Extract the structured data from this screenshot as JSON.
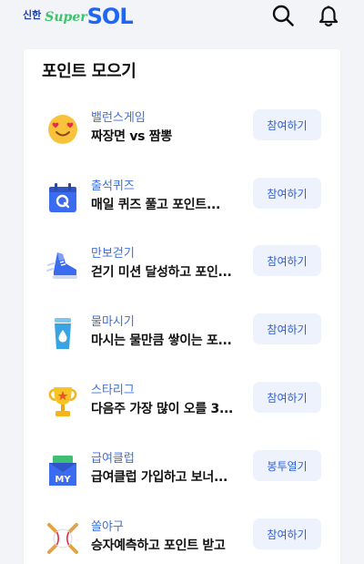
{
  "header": {
    "logo_prefix": "신한",
    "logo_super": "Super",
    "logo_sol": "SOL"
  },
  "section": {
    "title": "포인트 모으기"
  },
  "items": [
    {
      "category": "밸런스게임",
      "description": "짜장면 vs 짬뽕",
      "button": "참여하기",
      "icon": "heart-eyes-emoji-icon"
    },
    {
      "category": "출석퀴즈",
      "description": "매일 퀴즈 풀고 포인트...",
      "button": "참여하기",
      "icon": "quiz-calendar-icon"
    },
    {
      "category": "만보걷기",
      "description": "걷기 미션 달성하고 포인...",
      "button": "참여하기",
      "icon": "sneaker-icon"
    },
    {
      "category": "물마시기",
      "description": "마시는 물만큼 쌓이는 포...",
      "button": "참여하기",
      "icon": "water-cup-icon"
    },
    {
      "category": "스타리그",
      "description": "다음주 가장 많이 오를 3...",
      "button": "참여하기",
      "icon": "trophy-icon"
    },
    {
      "category": "급여클럽",
      "description": "급여클럽 가입하고 보너...",
      "button": "봉투열기",
      "icon": "money-envelope-icon"
    },
    {
      "category": "쏠야구",
      "description": "승자예측하고 포인트 받고",
      "button": "참여하기",
      "icon": "baseball-icon"
    }
  ]
}
